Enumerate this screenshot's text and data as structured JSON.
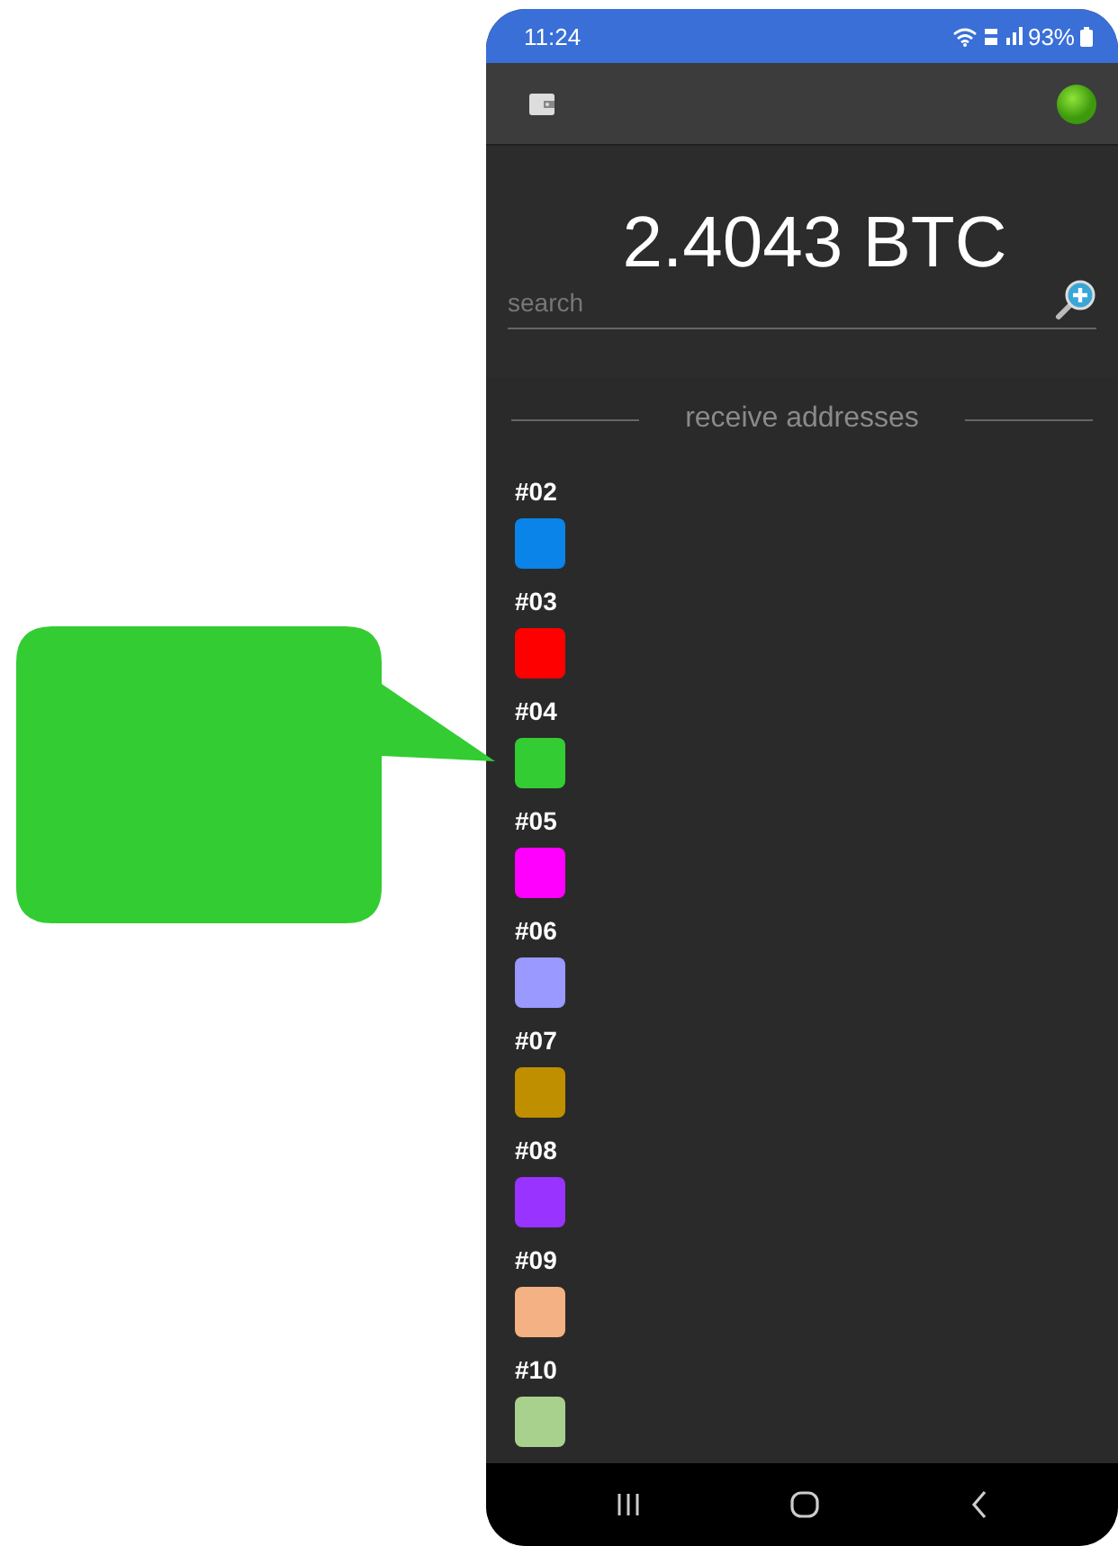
{
  "status_bar": {
    "time": "11:24",
    "battery": "93%"
  },
  "balance": "2.4043 BTC",
  "search": {
    "placeholder": "search"
  },
  "section_title": "receive addresses",
  "addresses": [
    {
      "label": "#02",
      "color": "#0a84e8"
    },
    {
      "label": "#03",
      "color": "#ff0000"
    },
    {
      "label": "#04",
      "color": "#33cc33"
    },
    {
      "label": "#05",
      "color": "#ff00ff"
    },
    {
      "label": "#06",
      "color": "#9999ff"
    },
    {
      "label": "#07",
      "color": "#bf8f00"
    },
    {
      "label": "#08",
      "color": "#9933ff"
    },
    {
      "label": "#09",
      "color": "#f4b183"
    },
    {
      "label": "#10",
      "color": "#a9d18e"
    }
  ]
}
